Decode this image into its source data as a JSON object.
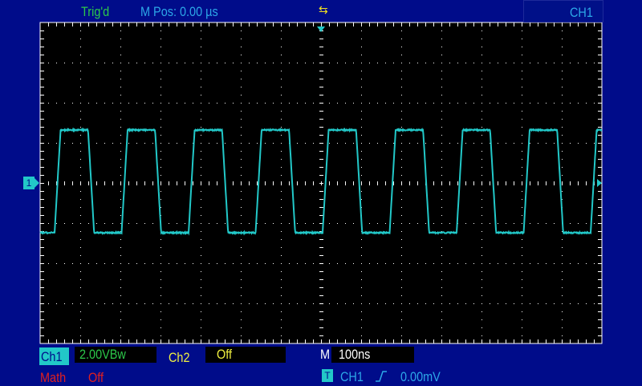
{
  "header": {
    "trigger_status": "Trig'd",
    "m_pos": "M Pos: 0.00 µs",
    "usb_icon": "usb-icon",
    "channel_menu": "CH1"
  },
  "markers": {
    "ground": "1",
    "trigger_level": "◄"
  },
  "footer": {
    "ch1_label": "Ch1",
    "ch1_scale": "2.00VBw",
    "ch2_label": "Ch2",
    "ch2_value": "Off",
    "math_label": "Math",
    "math_value": "Off",
    "time_label": "M",
    "time_scale": "100ns",
    "trig_icon": "T",
    "trig_source": "CH1",
    "trig_slope": "rising-edge",
    "trig_level": "0.00mV"
  },
  "colors": {
    "background": "#000c8a",
    "ch1": "#22c8c8",
    "grid": "#ffffff",
    "math": "#e02020",
    "ch2": "#f0f040"
  },
  "chart_data": {
    "type": "line",
    "title": "CH1 square wave",
    "x_unit": "ns",
    "y_unit": "V",
    "xlim": [
      -700,
      700
    ],
    "ylim": [
      -8,
      8
    ],
    "x_divisions": 14,
    "y_divisions": 8,
    "volts_per_div": 2.0,
    "time_per_div_ns": 100,
    "series": [
      {
        "name": "CH1",
        "period_ns": 167,
        "high_v": 2.64,
        "low_v": -2.48,
        "first_rising_edge_ns": -664,
        "duty": 0.5
      }
    ]
  }
}
